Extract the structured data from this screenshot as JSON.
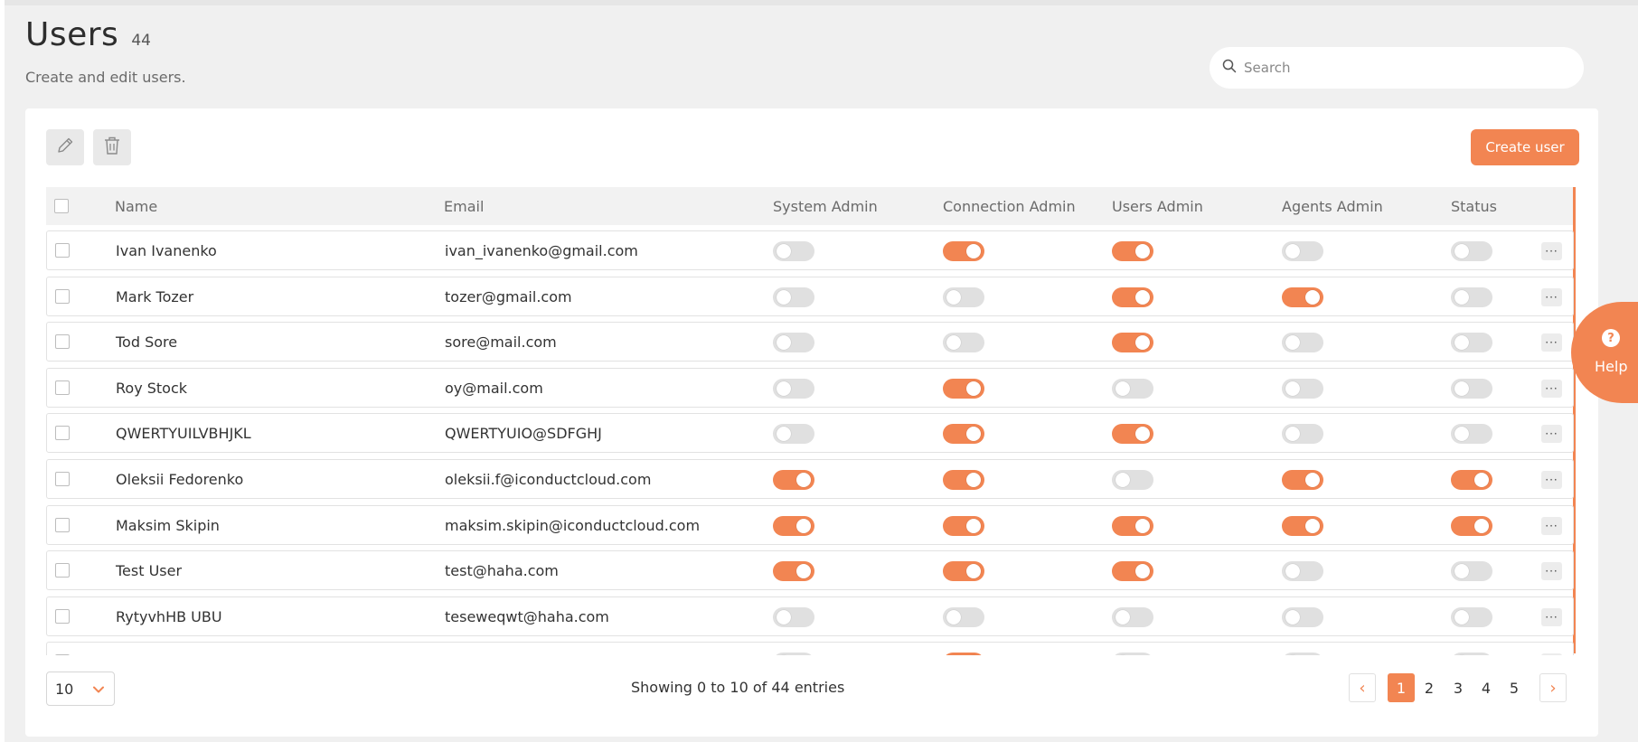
{
  "header": {
    "title": "Users",
    "count": "44",
    "subtitle": "Create and edit users."
  },
  "search": {
    "placeholder": "Search",
    "value": ""
  },
  "toolbar": {
    "create_label": "Create user"
  },
  "colors": {
    "accent": "#f28552",
    "toggle_off": "#e0e0e0"
  },
  "table": {
    "columns": [
      "Name",
      "Email",
      "System Admin",
      "Connection Admin",
      "Users Admin",
      "Agents Admin",
      "Status"
    ],
    "rows": [
      {
        "name": "Ivan Ivanenko",
        "email": "ivan_ivanenko@gmail.com",
        "system_admin": false,
        "connection_admin": true,
        "users_admin": true,
        "agents_admin": false,
        "status": false
      },
      {
        "name": "Mark Tozer",
        "email": "tozer@gmail.com",
        "system_admin": false,
        "connection_admin": false,
        "users_admin": true,
        "agents_admin": true,
        "status": false
      },
      {
        "name": "Tod Sore",
        "email": "sore@mail.com",
        "system_admin": false,
        "connection_admin": false,
        "users_admin": true,
        "agents_admin": false,
        "status": false
      },
      {
        "name": "Roy Stock",
        "email": "oy@mail.com",
        "system_admin": false,
        "connection_admin": true,
        "users_admin": false,
        "agents_admin": false,
        "status": false
      },
      {
        "name": "QWERTYUILVBHJKL",
        "email": "QWERTYUIO@SDFGHJ",
        "system_admin": false,
        "connection_admin": true,
        "users_admin": true,
        "agents_admin": false,
        "status": false
      },
      {
        "name": "Oleksii Fedorenko",
        "email": "oleksii.f@iconductcloud.com",
        "system_admin": true,
        "connection_admin": true,
        "users_admin": false,
        "agents_admin": true,
        "status": true
      },
      {
        "name": "Maksim Skipin",
        "email": "maksim.skipin@iconductcloud.com",
        "system_admin": true,
        "connection_admin": true,
        "users_admin": true,
        "agents_admin": true,
        "status": true
      },
      {
        "name": "Test User",
        "email": "test@haha.com",
        "system_admin": true,
        "connection_admin": true,
        "users_admin": true,
        "agents_admin": false,
        "status": false
      },
      {
        "name": "RytyvhHB UBU",
        "email": "teseweqwt@haha.com",
        "system_admin": false,
        "connection_admin": false,
        "users_admin": false,
        "agents_admin": false,
        "status": false
      },
      {
        "name": "",
        "email": "",
        "system_admin": false,
        "connection_admin": true,
        "users_admin": false,
        "agents_admin": false,
        "status": false
      }
    ]
  },
  "footer": {
    "page_size": "10",
    "showing": "Showing 0 to 10 of 44 entries",
    "pages": [
      "1",
      "2",
      "3",
      "4",
      "5"
    ],
    "active_page": "1",
    "prev": "‹",
    "next": "›"
  },
  "help": {
    "label": "Help",
    "icon": "?"
  }
}
